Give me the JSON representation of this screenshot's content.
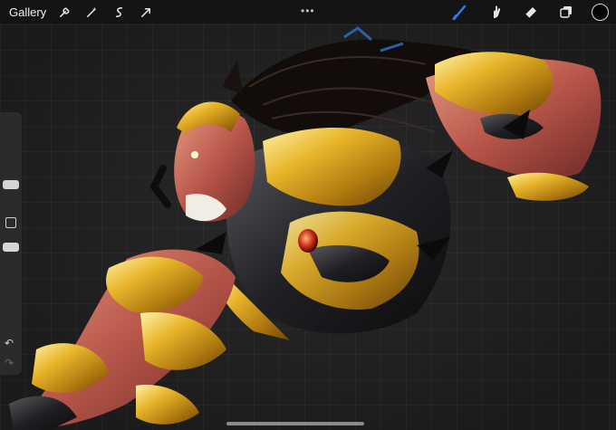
{
  "toolbar": {
    "gallery_label": "Gallery",
    "left_tools": [
      {
        "icon": "wrench-icon"
      },
      {
        "icon": "magic-wand-icon"
      },
      {
        "icon": "selection-icon"
      },
      {
        "icon": "transform-arrow-icon"
      }
    ],
    "more_dots": "•••",
    "right_tools": [
      {
        "icon": "brush-icon",
        "active": true
      },
      {
        "icon": "smudge-icon"
      },
      {
        "icon": "eraser-icon"
      },
      {
        "icon": "layers-icon"
      }
    ],
    "active_color": "#050505",
    "accent_color": "#2f7cf6"
  },
  "sidebar": {
    "undo_symbol": "↶",
    "redo_symbol": "↷"
  }
}
